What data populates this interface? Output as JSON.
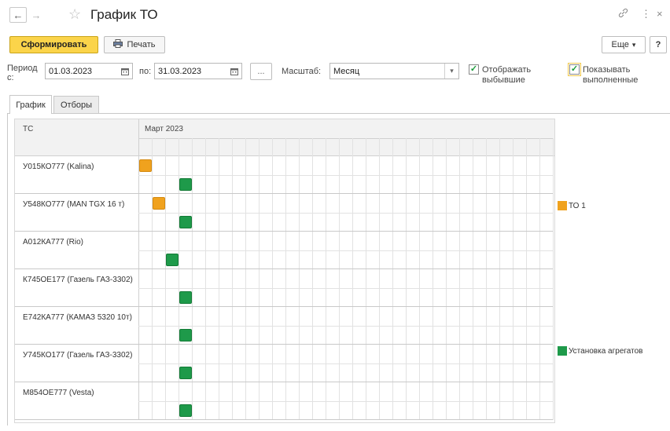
{
  "window": {
    "title": "График ТО",
    "back_icon": "←",
    "forward_icon": "→",
    "star_icon": "☆",
    "link_icon": "🔗",
    "menu_icon": "⋮",
    "close_icon": "×"
  },
  "toolbar": {
    "generate_label": "Сформировать",
    "print_label": "Печать",
    "more_label": "Еще",
    "more_arrow": "▾",
    "help_label": "?"
  },
  "filters": {
    "period_label_1": "Период",
    "period_label_2": "с:",
    "date_from": "01.03.2023",
    "to_label": "по:",
    "date_to": "31.03.2023",
    "ellipsis_label": "...",
    "scale_label": "Масштаб:",
    "scale_value": "Месяц",
    "show_retired_checked": true,
    "show_retired_label_1": "Отображать",
    "show_retired_label_2": "выбывшие",
    "show_completed_checked": true,
    "show_completed_label_1": "Показывать",
    "show_completed_label_2": "выполненные",
    "check_mark": "✓"
  },
  "tabs": [
    {
      "label": "График",
      "active": true
    },
    {
      "label": "Отборы",
      "active": false
    }
  ],
  "gantt": {
    "column_header": "ТС",
    "period_header": "Март 2023",
    "days_in_month": 31,
    "vehicles": [
      {
        "name": "У015КО777 (Kalina)",
        "tasks": [
          {
            "type": "TO1",
            "day": 1
          },
          {
            "type": "install",
            "day": 4
          }
        ]
      },
      {
        "name": "У548КО777 (MAN TGX  16 т)",
        "tasks": [
          {
            "type": "TO1",
            "day": 2
          },
          {
            "type": "install",
            "day": 4
          }
        ]
      },
      {
        "name": "А012КА777 (Rio)",
        "tasks": [
          {
            "type": "install",
            "day": 3
          }
        ]
      },
      {
        "name": "К745ОЕ177 (Газель ГАЗ-3302)",
        "tasks": [
          {
            "type": "install",
            "day": 4
          }
        ]
      },
      {
        "name": "Е742КА777 (КАМАЗ 5320 10т)",
        "tasks": [
          {
            "type": "install",
            "day": 4
          }
        ]
      },
      {
        "name": "У745КО177 (Газель ГАЗ-3302)",
        "tasks": [
          {
            "type": "install",
            "day": 4
          }
        ]
      },
      {
        "name": "М854ОЕ777 (Vesta)",
        "tasks": [
          {
            "type": "install",
            "day": 4
          }
        ]
      }
    ]
  },
  "legend": {
    "to1_label": "ТО 1",
    "to1_color": "#f0a21e",
    "install_label": "Установка агрегатов",
    "install_color": "#1e9a4a"
  }
}
